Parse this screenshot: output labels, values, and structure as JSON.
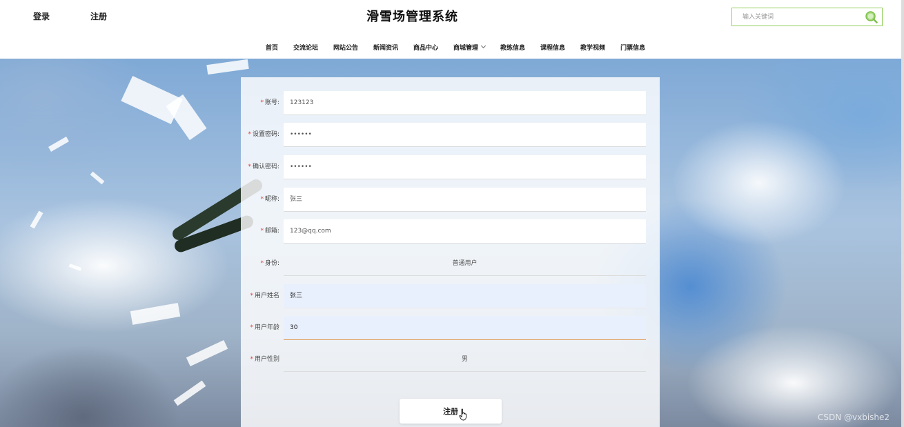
{
  "header": {
    "login_label": "登录",
    "register_label": "注册",
    "title": "滑雪场管理系统",
    "search_placeholder": "输入关键词"
  },
  "nav": {
    "items": [
      "首页",
      "交流论坛",
      "网站公告",
      "新闻资讯",
      "商品中心",
      "商城管理",
      "教练信息",
      "课程信息",
      "教学视频",
      "门票信息"
    ]
  },
  "form": {
    "account": {
      "label": "账号:",
      "value": "123123"
    },
    "password": {
      "label": "设置密码:",
      "value": "••••••"
    },
    "confirm_password": {
      "label": "确认密码:",
      "value": "••••••"
    },
    "nickname": {
      "label": "昵称:",
      "value": "张三"
    },
    "email": {
      "label": "邮箱:",
      "value": "123@qq.com"
    },
    "identity": {
      "label": "身份:",
      "value": "普通用户"
    },
    "real_name": {
      "label": "用户姓名",
      "value": "张三"
    },
    "age": {
      "label": "用户年龄",
      "value": "30"
    },
    "gender": {
      "label": "用户性别",
      "value": "男"
    },
    "required_mark": "*",
    "submit_label": "注册"
  },
  "watermark": "CSDN @vxbishe2",
  "colors": {
    "search_border": "#8fcf5a",
    "search_icon": "#7cc04a",
    "required": "#e53935",
    "focus_underline": "#e29a52",
    "filled_field": "#e9f0fd"
  }
}
